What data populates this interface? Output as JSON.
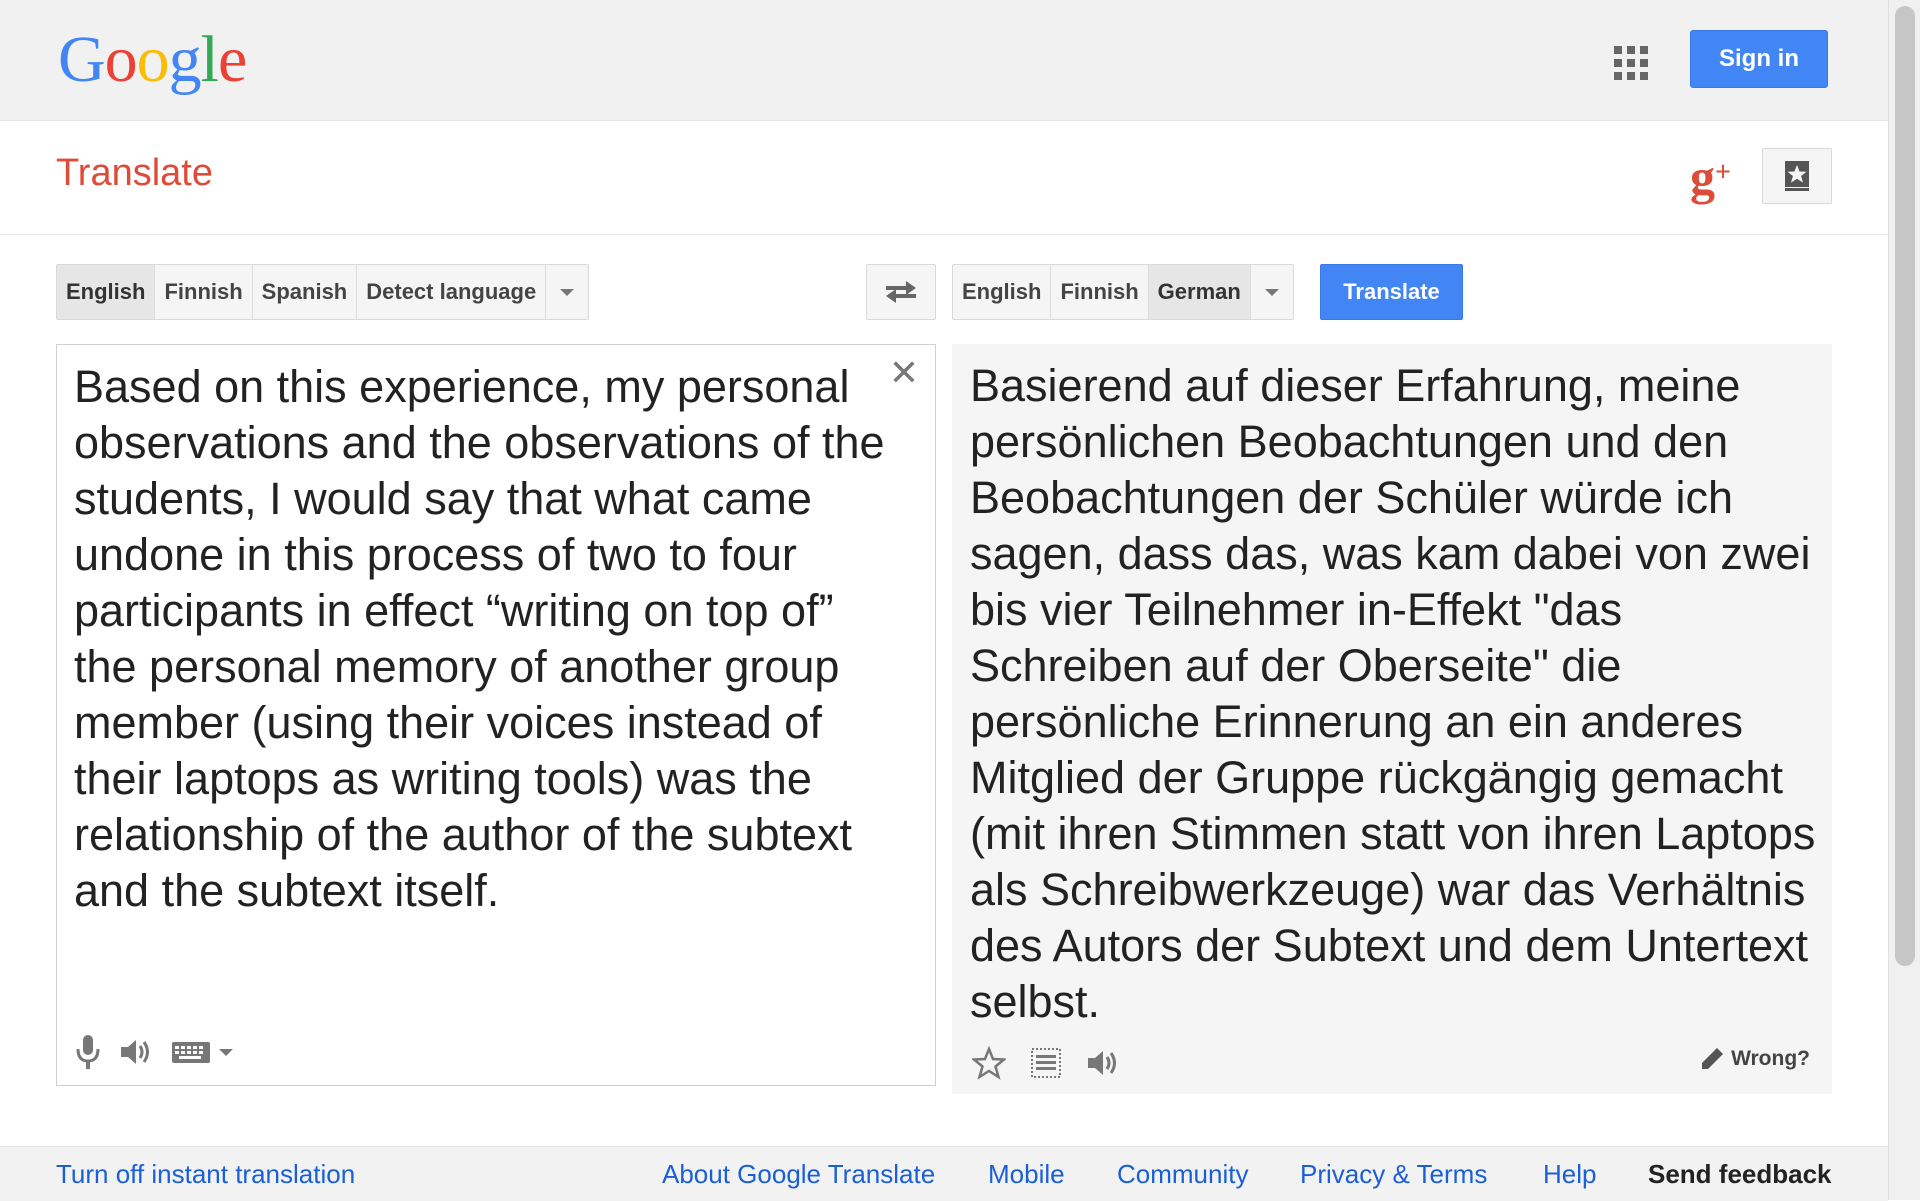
{
  "header": {
    "logo_letters": [
      {
        "ch": "G",
        "color": "#4285f4"
      },
      {
        "ch": "o",
        "color": "#ea4335"
      },
      {
        "ch": "o",
        "color": "#fbbc05"
      },
      {
        "ch": "g",
        "color": "#4285f4"
      },
      {
        "ch": "l",
        "color": "#34a853"
      },
      {
        "ch": "e",
        "color": "#ea4335"
      }
    ],
    "signin_label": "Sign in",
    "apps_icon": "apps-grid-icon"
  },
  "subheader": {
    "title": "Translate",
    "gplus_label": "g+",
    "phrasebook_icon": "phrasebook-star-icon"
  },
  "source_langs": {
    "items": [
      {
        "label": "English",
        "selected": true
      },
      {
        "label": "Finnish",
        "selected": false
      },
      {
        "label": "Spanish",
        "selected": false
      },
      {
        "label": "Detect language",
        "selected": false
      }
    ]
  },
  "target_langs": {
    "items": [
      {
        "label": "English",
        "selected": false
      },
      {
        "label": "Finnish",
        "selected": false
      },
      {
        "label": "German",
        "selected": true
      }
    ]
  },
  "translate_label": "Translate",
  "source": {
    "text": "Based on this experience, my personal observations and the observations of the students, I would say that what came undone in this process of two to four participants in effect “writing on top of” the personal memory of another group member (using their voices instead of their laptops as writing tools) was the relationship of the author of the subtext and the subtext itself."
  },
  "result": {
    "text": "Basierend auf dieser Erfahrung, meine persönlichen Beobachtungen und den Beobachtungen der Schüler würde ich sagen, dass das, was kam dabei von zwei bis vier Teilnehmer in-Effekt \"das Schreiben auf der Oberseite\" die persönliche Erinnerung an ein anderes Mitglied der Gruppe rückgängig gemacht (mit ihren Stimmen statt von ihren Laptops als Schreibwerkzeuge) war das Verhältnis des Autors der Subtext und dem Untertext selbst.",
    "wrong_label": "Wrong?"
  },
  "footer": {
    "instant": "Turn off instant translation",
    "about": "About Google Translate",
    "mobile": "Mobile",
    "community": "Community",
    "privacy": "Privacy & Terms",
    "help": "Help",
    "feedback": "Send feedback"
  },
  "colors": {
    "accent_blue": "#4285f4",
    "brand_red": "#dd4b39",
    "link_blue": "#1a5fd6"
  }
}
